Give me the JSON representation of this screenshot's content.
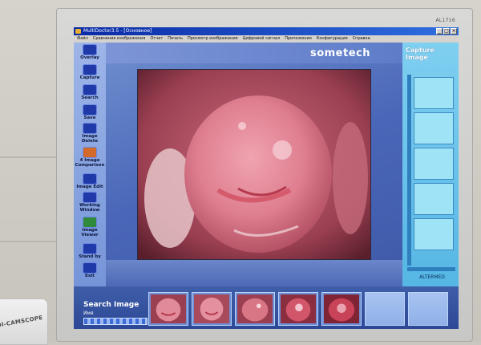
{
  "monitor": {
    "model": "AL1716"
  },
  "window": {
    "title": "MultiDoctor3.5 - [Основное]",
    "controls": [
      "_",
      "□",
      "×"
    ]
  },
  "menu": [
    "Файл",
    "Сравнение изображения",
    "Отчет",
    "Печать",
    "Просмотр изображения",
    "Цифровой сигнал",
    "Приложения",
    "Конфигурация",
    "Справка"
  ],
  "toolbar": [
    {
      "label": "Overlay",
      "icon": "overlay-icon"
    },
    {
      "label": "Capture",
      "icon": "capture-icon"
    },
    {
      "label": "Search",
      "icon": "search-icon"
    },
    {
      "label": "Save",
      "icon": "save-icon"
    },
    {
      "label": "Image Delete",
      "icon": "image-delete-icon"
    },
    {
      "label": "4 Image Comparison",
      "icon": "four-image-icon"
    },
    {
      "label": "Image Edit",
      "icon": "image-edit-icon"
    },
    {
      "label": "Working Window",
      "icon": "working-window-icon"
    },
    {
      "label": "Image Viewer",
      "icon": "image-viewer-icon"
    },
    {
      "label": "Stand by",
      "icon": "stand-by-icon"
    },
    {
      "label": "Exit",
      "icon": "exit-icon"
    }
  ],
  "brand": "sometech",
  "capture_panel": {
    "title": "Capture Image",
    "slots": 5,
    "footer": "ALTERMED"
  },
  "search": {
    "title": "Search Image",
    "name_label": "Имя"
  },
  "thumbnails": [
    {
      "filled": true
    },
    {
      "filled": true
    },
    {
      "filled": true
    },
    {
      "filled": true
    },
    {
      "filled": true
    },
    {
      "filled": false
    },
    {
      "filled": false
    }
  ],
  "device": {
    "label": "DI-CAMSCOPE"
  },
  "colors": {
    "title_bar": "#0a2aa6",
    "panel_blue": "#4a66b8",
    "capture_cyan": "#7fcff0",
    "tissue": "#d97686"
  }
}
